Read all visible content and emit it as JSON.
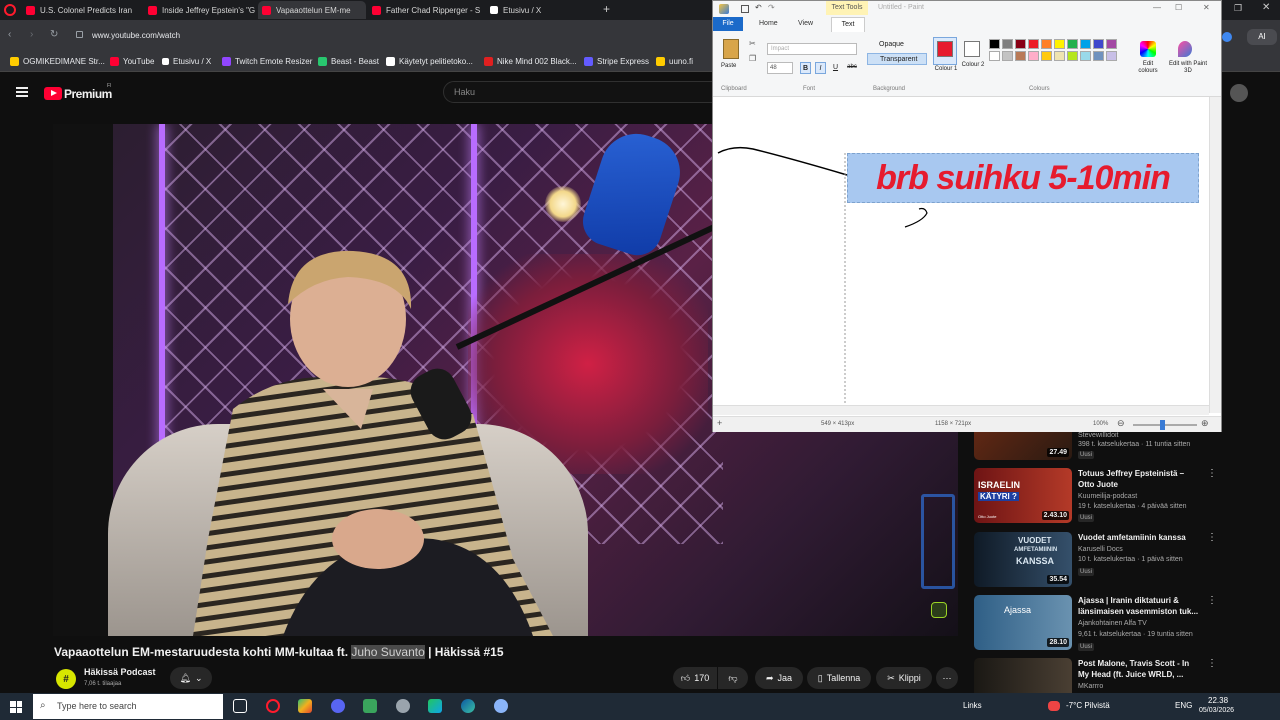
{
  "browser": {
    "tabs": [
      {
        "label": "U.S. Colonel Predicts Iran",
        "color": "#ff0033"
      },
      {
        "label": "Inside Jeffrey Epstein's \"G",
        "color": "#ff0033"
      },
      {
        "label": "Vapaaottelun EM-me",
        "color": "#ff0033"
      },
      {
        "label": "Father Chad Ripperger - S",
        "color": "#ff0033"
      },
      {
        "label": "Etusivu / X",
        "color": "#ffffff"
      }
    ],
    "url": "www.youtube.com/watch",
    "bookmarks": [
      {
        "label": "OGMIKEDIMANE Str...",
        "color": "#ffcc00"
      },
      {
        "label": "YouTube",
        "color": "#ff0033"
      },
      {
        "label": "Etusivu / X",
        "color": "#ffffff"
      },
      {
        "label": "Twitch Emote Resizer",
        "color": "#9146ff"
      },
      {
        "label": "Beast - Beast",
        "color": "#28c76f"
      },
      {
        "label": "Käytetyt pelitietoko...",
        "color": "#ffffff"
      },
      {
        "label": "Nike Mind 002 Black...",
        "color": "#e02020"
      },
      {
        "label": "Stripe Express",
        "color": "#635bff"
      },
      {
        "label": "uuno.fi",
        "color": "#ffcc00"
      }
    ]
  },
  "youtube": {
    "brand": "Premium",
    "brand_sup": "FI",
    "search_placeholder": "Haku",
    "video": {
      "title_pre": "Vapaaottelun EM-mestaruudesta kohti MM-kultaa ft. ",
      "title_highlight": "Juho Suvanto",
      "title_post": " | Häkissä #15",
      "channel": "Häkissä Podcast",
      "subscribers": "7,06 t. tilaajaa",
      "likes": "170",
      "share_label": "Jaa",
      "save_label": "Tallenna",
      "clip_label": "Klippi"
    },
    "recommendations": [
      {
        "title": "",
        "channel": "Stevewillidoit",
        "meta": "398 t. katselukertaa · 11 tuntia sitten",
        "badge": "Uusi",
        "duration": "27.49",
        "thumb": "#5a2a1a"
      },
      {
        "title": "Totuus Jeffrey Epsteinistä – Otto Juote",
        "channel": "Kuumeilija-podcast",
        "meta": "19 t. katselukertaa · 4 päivää sitten",
        "badge": "Uusi",
        "duration": "2.43.10",
        "thumb": "#7a1515",
        "thumb_text1": "ISRAELIN",
        "thumb_text2": "KÄTYRI ?",
        "thumb_text3": "Otto Juote"
      },
      {
        "title": "Vuodet amfetamiinin kanssa",
        "channel": "Karuselli Docs",
        "meta": "10 t. katselukertaa · 1 päivä sitten",
        "badge": "Uusi",
        "duration": "35.54",
        "thumb": "#1e3346",
        "thumb_text1": "VUODET",
        "thumb_text2": "AMFETAMIININ",
        "thumb_text3": "KANSSA"
      },
      {
        "title": "Ajassa | Iranin diktatuuri & länsimaisen vasemmiston tuk...",
        "channel": "Ajankohtainen Alfa TV",
        "meta": "9,61 t. katselukertaa · 19 tuntia sitten",
        "badge": "Uusi",
        "duration": "28.10",
        "thumb": "#3f6a8a",
        "thumb_text1": "Ajassa"
      },
      {
        "title": "Post Malone, Travis Scott - In My Head (ft. Juice WRLD, ...",
        "channel": "MKarrro",
        "meta": "",
        "badge": "",
        "duration": "",
        "thumb": "#2a2520"
      }
    ]
  },
  "paint": {
    "title": "Untitled - Paint",
    "text_tools_label": "Text Tools",
    "text_tab": "Text",
    "tabs": [
      "File",
      "Home",
      "View"
    ],
    "clipboard_label": "Clipboard",
    "paste_label": "Paste",
    "font_label": "Font",
    "font_name": "Impact",
    "font_size": "48",
    "background_label": "Background",
    "opaque_label": "Opaque",
    "transparent_label": "Transparent",
    "colour1_label": "Colour 1",
    "colour2_label": "Colour 2",
    "colours_label": "Colours",
    "edit_colours_label": "Edit colours",
    "edit_paint3d_label": "Edit with Paint 3D",
    "canvas_text": "brb suihku 5-10min",
    "status_pos": "549 × 413px",
    "status_size": "1158 × 721px",
    "zoom": "100%",
    "colour1": "#e61b2e",
    "colour2": "#ffffff",
    "palette": [
      "#000000",
      "#7f7f7f",
      "#880015",
      "#ed1c24",
      "#ff7f27",
      "#fff200",
      "#22b14c",
      "#00a2e8",
      "#3f48cc",
      "#a349a4",
      "#ffffff",
      "#c3c3c3",
      "#b97a57",
      "#ffaec9",
      "#ffc90e",
      "#efe4b0",
      "#b5e61d",
      "#99d9ea",
      "#7092be",
      "#c8bfe7"
    ]
  },
  "taskbar": {
    "search_placeholder": "Type here to search",
    "links_label": "Links",
    "weather": "-7°C  Pilvistä",
    "language": "ENG",
    "time": "22.38",
    "date": "05/03/2026"
  }
}
